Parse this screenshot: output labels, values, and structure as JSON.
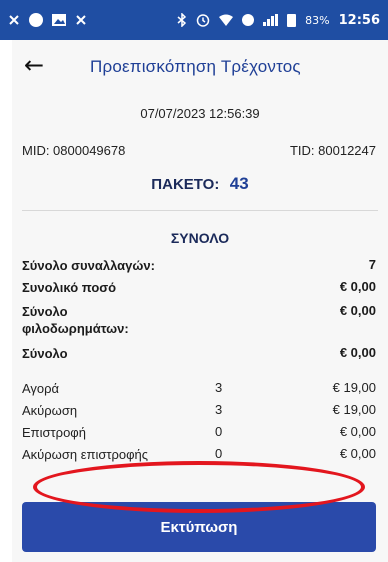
{
  "statusbar": {
    "left_icons": [
      "close-icon",
      "circle-icon",
      "image-icon",
      "close-icon"
    ],
    "right_icons": [
      "bluetooth-icon",
      "alarm-icon",
      "wifi-icon",
      "data-icon",
      "signal-icon",
      "battery-icon"
    ],
    "battery": "83%",
    "time": "12:56"
  },
  "appbar": {
    "back_icon": "arrow-left-icon",
    "title": "Προεπισκόπηση Τρέχοντος"
  },
  "header": {
    "datetime": "07/07/2023 12:56:39",
    "mid": "MID: 0800049678",
    "tid": "TID: 80012247"
  },
  "packet": {
    "label": "ΠΑΚΕΤΟ:",
    "number": "43"
  },
  "summary": {
    "heading": "ΣΥΝΟΛΟ",
    "rows": [
      {
        "label": "Σύνολο συναλλαγών:",
        "value": "7"
      },
      {
        "label": "Συνολικό ποσό",
        "value": "€ 0,00"
      },
      {
        "label": "Σύνολο φιλοδωρημάτων:",
        "value": "€ 0,00"
      },
      {
        "label": "Σύνολο",
        "value": "€ 0,00"
      }
    ]
  },
  "transactions": [
    {
      "label": "Αγορά",
      "count": "3",
      "amount": "€ 19,00"
    },
    {
      "label": "Ακύρωση",
      "count": "3",
      "amount": "€ 19,00"
    },
    {
      "label": "Επιστροφή",
      "count": "0",
      "amount": "€ 0,00"
    },
    {
      "label": "Ακύρωση επιστροφής",
      "count": "0",
      "amount": "€ 0,00"
    }
  ],
  "actions": {
    "print_label": "Εκτύπωση"
  },
  "colors": {
    "statusbar": "#1f4ea3",
    "title": "#1f3f96",
    "button": "#2a4aaa",
    "highlight": "#e3161e"
  }
}
